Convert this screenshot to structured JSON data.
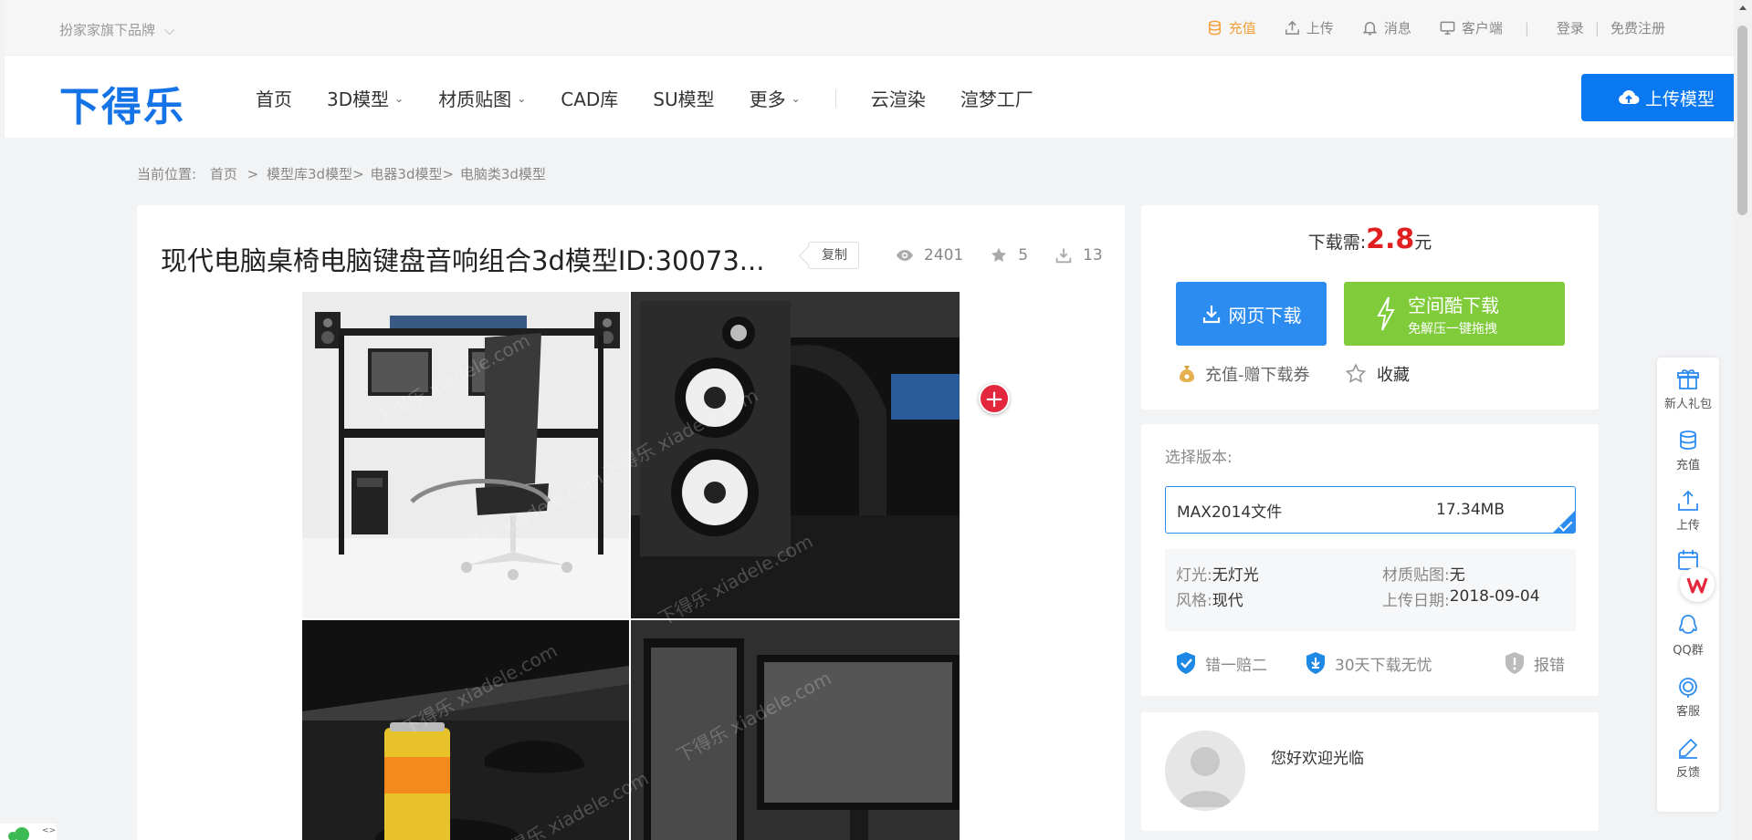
{
  "topbar": {
    "brand_selector": "扮家家旗下品牌",
    "links": {
      "recharge": "充值",
      "upload": "上传",
      "messages": "消息",
      "client": "客户端",
      "login": "登录",
      "separator": "|",
      "register": "免费注册"
    }
  },
  "nav": {
    "logo": "下得乐",
    "items": [
      {
        "label": "首页",
        "dropdown": false
      },
      {
        "label": "3D模型",
        "dropdown": true
      },
      {
        "label": "材质贴图",
        "dropdown": true
      },
      {
        "label": "CAD库",
        "dropdown": false
      },
      {
        "label": "SU模型",
        "dropdown": false
      },
      {
        "label": "更多",
        "dropdown": true
      }
    ],
    "extra_items": [
      "云渲染",
      "渲梦工厂"
    ],
    "upload_button": "上传模型"
  },
  "breadcrumb": {
    "prefix": "当前位置:",
    "items": [
      "首页",
      ">",
      "模型库3d模型>",
      "电器3d模型>",
      "电脑类3d模型"
    ]
  },
  "model": {
    "title": "现代电脑桌椅电脑键盘音响组合3d模型ID:30073...",
    "copy_label": "复制",
    "views": "2401",
    "favorites": "5",
    "downloads": "13",
    "watermark": "下得乐 xiadele.com"
  },
  "download": {
    "price_prefix": "下载需:",
    "price_value": "2.8",
    "price_unit": "元",
    "web_download": "网页下载",
    "space_download": "空间酷下载",
    "space_download_sub": "免解压一键拖拽",
    "coupon": "充值-赠下载券",
    "favorite": "收藏"
  },
  "version": {
    "label": "选择版本:",
    "file": "MAX2014文件",
    "size": "17.34MB",
    "props": {
      "lighting_k": "灯光:",
      "lighting_v": "无灯光",
      "material_k": "材质贴图:",
      "material_v": "无",
      "style_k": "风格:",
      "style_v": "现代",
      "date_k": "上传日期:",
      "date_v": "2018-09-04"
    },
    "guarantees": [
      "错一赔二",
      "30天下载无忧",
      "报错"
    ]
  },
  "user": {
    "welcome": "您好欢迎光临"
  },
  "side_tools": [
    "新人礼包",
    "充值",
    "上传",
    "QQ群",
    "客服",
    "反馈"
  ],
  "colors": {
    "brand_blue": "#1473e6",
    "button_blue": "#2d8cf0",
    "button_green": "#7fcb3a",
    "price_red": "#e02020",
    "recharge_orange": "#f3a03a"
  }
}
